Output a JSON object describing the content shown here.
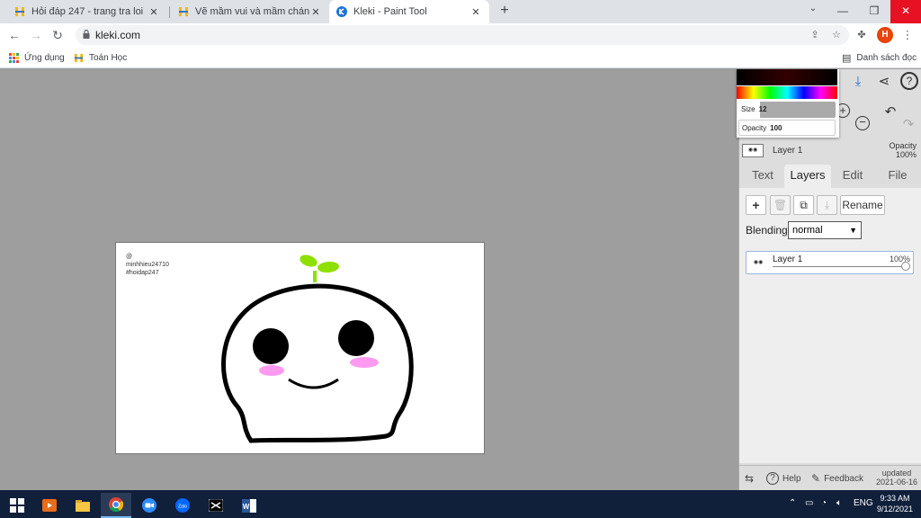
{
  "browser": {
    "tabs": [
      {
        "title": "Hỏi đáp 247 - trang tra loi",
        "close": "✕"
      },
      {
        "title": "Vẽ mầm vui và mầm chán đời Tổ",
        "close": "✕"
      },
      {
        "title": "Kleki - Paint Tool",
        "close": "✕"
      }
    ],
    "new_tab": "+",
    "url": "kleki.com",
    "avatar_letter": "H",
    "bookmarks": [
      {
        "label": "Ứng dụng"
      },
      {
        "label": "Toán Học"
      }
    ],
    "reading_list": "Danh sách đọc"
  },
  "canvas": {
    "watermark": [
      "@",
      "minhhieu24710",
      "#hoidap247"
    ]
  },
  "panel": {
    "size_label": "Size",
    "size_value": "12",
    "opacity_label": "Opacity",
    "opacity_value": "100",
    "layer_name": "Layer 1",
    "layer_opacity_label": "Opacity",
    "layer_opacity_value": "100%",
    "tabs": [
      "Text",
      "Layers",
      "Edit",
      "File"
    ],
    "active_tab": "Layers",
    "rename_label": "Rename",
    "blending_label": "Blending",
    "blending_value": "normal",
    "layers": [
      {
        "name": "Layer 1",
        "opacity": "100%"
      }
    ],
    "footer": {
      "help": "Help",
      "feedback": "Feedback",
      "updated_label": "updated",
      "updated_date": "2021-06-16"
    }
  },
  "taskbar": {
    "language": "ENG",
    "time": "9:33 AM",
    "date": "9/12/2021"
  },
  "colors": {
    "accent_blue": "#1e73d6",
    "sprout_green": "#8ee000",
    "blush_pink": "#ff9af0",
    "taskbar": "#101f3a"
  }
}
